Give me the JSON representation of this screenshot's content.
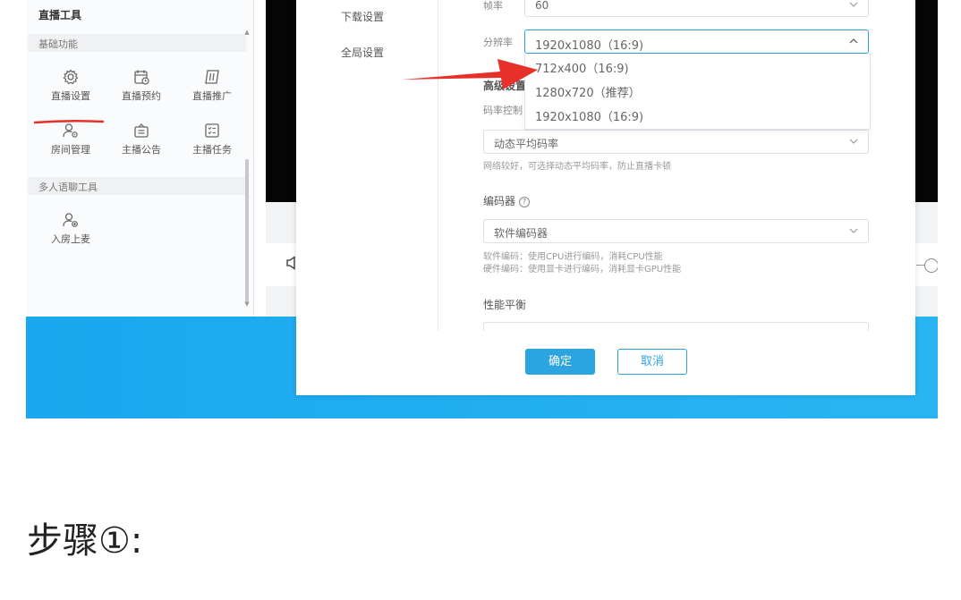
{
  "left_panel": {
    "title": "直播工具",
    "sections": [
      {
        "label": "基础功能",
        "tools": [
          {
            "label": "直播设置",
            "icon": "gear-icon"
          },
          {
            "label": "直播预约",
            "icon": "calendar-clock-icon"
          },
          {
            "label": "直播推广",
            "icon": "promo-icon"
          },
          {
            "label": "房间管理",
            "icon": "user-gear-icon"
          },
          {
            "label": "主播公告",
            "icon": "announcement-icon"
          },
          {
            "label": "主播任务",
            "icon": "task-list-icon"
          }
        ]
      },
      {
        "label": "多人语聊工具",
        "tools": [
          {
            "label": "入房上麦",
            "icon": "user-plus-icon"
          }
        ]
      }
    ]
  },
  "dialog": {
    "nav": [
      "下载设置",
      "全局设置"
    ],
    "fields": {
      "framerate": {
        "label": "帧率",
        "value": "60"
      },
      "resolution": {
        "label": "分辨率",
        "value": "1920x1080（16:9)",
        "options": [
          "712x400（16:9)",
          "1280x720（推荐）",
          "1920x1080（16:9)"
        ]
      },
      "advanced": {
        "label": "高级设置"
      },
      "bitrate": {
        "label": "码率控制",
        "value": "动态平均码率",
        "help": "网络较好，可选择动态平均码率，防止直播卡顿"
      },
      "encoder": {
        "label": "编码器",
        "value": "软件编码器",
        "help": [
          "软件编码：使用CPU进行编码，消耗CPU性能",
          "硬件编码：使用显卡进行编码，消耗显卡GPU性能"
        ]
      },
      "performance": {
        "label": "性能平衡"
      }
    },
    "buttons": {
      "ok": "确定",
      "cancel": "取消"
    }
  },
  "annotations": {
    "arrow_color": "#e8302a",
    "underline_color": "#e8302a"
  },
  "step_heading": "步骤①:"
}
